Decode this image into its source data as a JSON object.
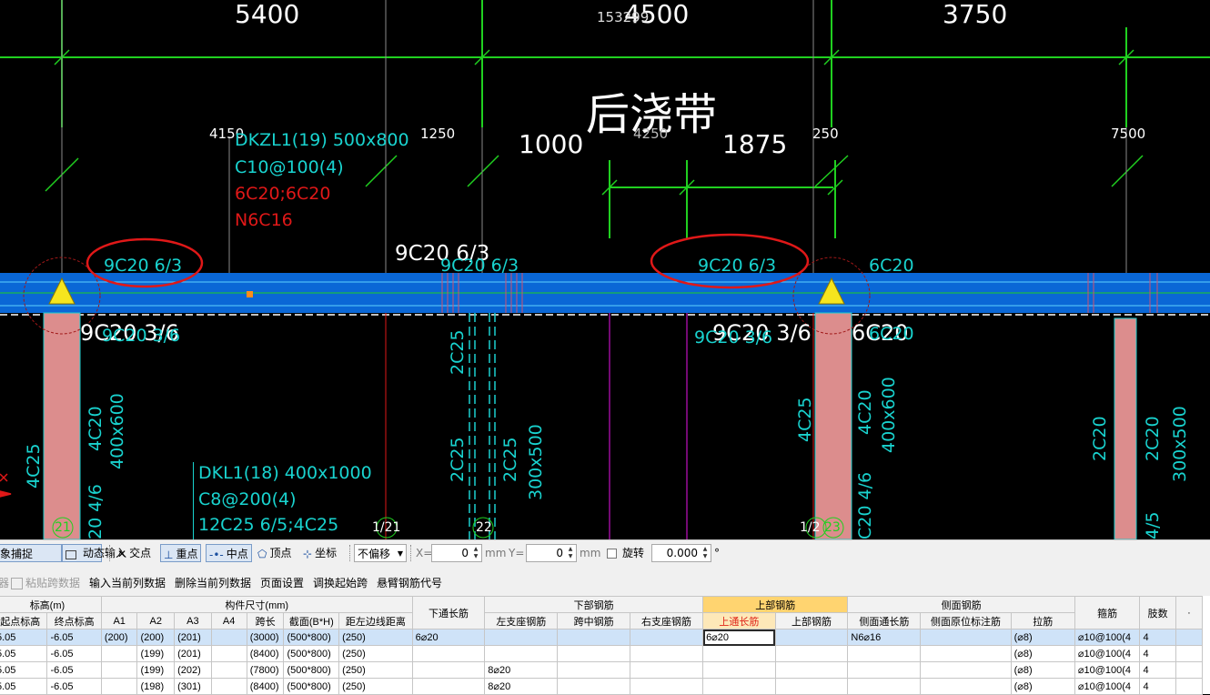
{
  "drawing": {
    "dims_top": [
      "5400",
      "4500",
      "3750"
    ],
    "overlap_num": "153299",
    "post_pour_label": "后浇带",
    "mid_dims": [
      "4150",
      "1250",
      "1000",
      "4250",
      "1875",
      "250",
      "7500"
    ],
    "beam1": {
      "name": "DKZL1(19) 500x800",
      "stirrup": "C10@100(4)",
      "top_bottom": "6C20;6C20",
      "side": "N6C16"
    },
    "beam2": {
      "name": "DKL1(18) 400x1000",
      "stirrup": "C8@200(4)",
      "bars": "12C25 6/5;4C25"
    },
    "span_labels": {
      "a": "9C20 6/3",
      "b": "9C20 6/3",
      "c": "9C20 6/3",
      "d": "9C20 6/3",
      "e": "6C20"
    },
    "bottom_labels": {
      "a": "9C20 3/6",
      "a2": "9C20 3/6",
      "b": "9C20 3/6",
      "b2": "9C20 3/6",
      "c": "6C20",
      "c2": "6C20"
    },
    "vertical_labels": [
      "4C25",
      "4C20",
      "400x600",
      "2C25",
      "2C25",
      "2C25",
      "300x500",
      "4C25",
      "4C20",
      "400x600",
      "2C20",
      "2C20",
      "300x500",
      "20 4/6",
      "C20 4/6",
      "4/5"
    ],
    "axis_marks": [
      "21",
      "1/21",
      "22",
      "1/2",
      "23"
    ]
  },
  "snapbar": {
    "snap_label": "象捕捉",
    "dynamic_input": "动态输入",
    "intersection": "交点",
    "perpendicular": "重点",
    "midpoint": "中点",
    "vertex": "顶点",
    "coordinate": "坐标",
    "offset_select": "不偏移",
    "x_label": "X=",
    "x_value": "0",
    "y_label": "Y=",
    "y_value": "0",
    "unit": "mm",
    "rotate_label": "旋转",
    "rotate_value": "0.000",
    "degree": "°"
  },
  "toolbar": {
    "paste_span": "粘贴跨数据",
    "input_current_col": "输入当前列数据",
    "delete_current_col": "删除当前列数据",
    "page_setup": "页面设置",
    "adjust_start_span": "调换起始跨",
    "cantilever_code": "悬臂钢筋代号"
  },
  "grid": {
    "group_headers": {
      "elevation": "标高(m)",
      "dimensions": "构件尺寸(mm)",
      "bottom_through": "下通长筋",
      "bottom_rebar": "下部钢筋",
      "top_rebar": "上部钢筋",
      "side_rebar": "侧面钢筋",
      "stirrup": "箍筋",
      "legs": "肢数"
    },
    "columns": [
      "起点标高",
      "终点标高",
      "A1",
      "A2",
      "A3",
      "A4",
      "跨长",
      "截面(B*H)",
      "距左边线距离",
      "左支座钢筋",
      "跨中钢筋",
      "右支座钢筋",
      "上通长筋",
      "上部钢筋",
      "侧面通长筋",
      "侧面原位标注筋",
      "拉筋"
    ],
    "rows": [
      [
        "5.05",
        "-6.05",
        "(200)",
        "(200)",
        "(201)",
        "",
        "(3000)",
        "(500*800)",
        "(250)",
        "6⌀20",
        "",
        "",
        "",
        "6⌀20",
        "",
        "N6⌀16",
        "",
        "(⌀8)",
        "⌀10@100(4",
        "4"
      ],
      [
        "5.05",
        "-6.05",
        "",
        "(199)",
        "(201)",
        "",
        "(8400)",
        "(500*800)",
        "(250)",
        "",
        "",
        "",
        "",
        "",
        "",
        "",
        "",
        "(⌀8)",
        "⌀10@100(4",
        "4"
      ],
      [
        "5.05",
        "-6.05",
        "",
        "(199)",
        "(202)",
        "",
        "(7800)",
        "(500*800)",
        "(250)",
        "",
        "8⌀20",
        "",
        "",
        "",
        "",
        "",
        "",
        "(⌀8)",
        "⌀10@100(4",
        "4"
      ],
      [
        "5.05",
        "-6.05",
        "",
        "(198)",
        "(301)",
        "",
        "(8400)",
        "(500*800)",
        "(250)",
        "",
        "8⌀20",
        "",
        "",
        "",
        "",
        "",
        "",
        "(⌀8)",
        "⌀10@100(4",
        "4"
      ]
    ]
  }
}
